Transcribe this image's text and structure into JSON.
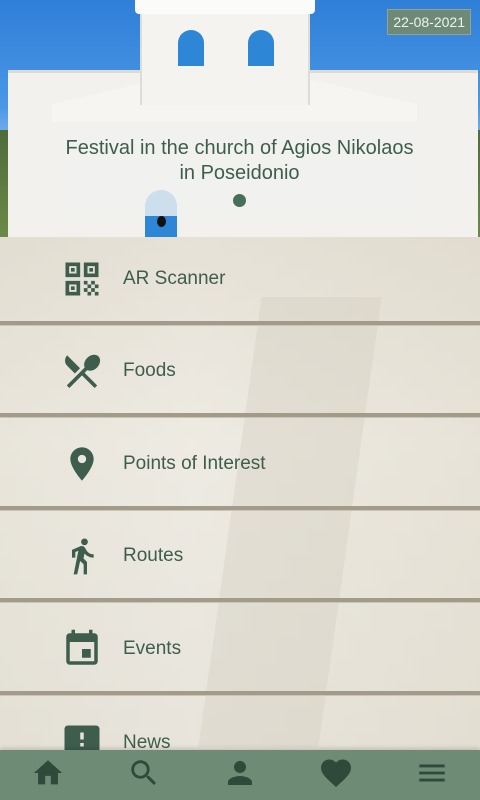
{
  "hero": {
    "date": "22-08-2021",
    "title": "Festival in the church of Agios Nikolaos in Poseidonio"
  },
  "menu": {
    "items": [
      {
        "label": "AR Scanner",
        "icon": "qr-code-icon"
      },
      {
        "label": "Foods",
        "icon": "fork-knife-icon"
      },
      {
        "label": "Points of Interest",
        "icon": "location-pin-icon"
      },
      {
        "label": "Routes",
        "icon": "walking-person-icon"
      },
      {
        "label": "Events",
        "icon": "calendar-icon"
      },
      {
        "label": "News",
        "icon": "news-icon"
      }
    ]
  },
  "bottom_nav": {
    "items": [
      "home-icon",
      "search-icon",
      "profile-icon",
      "favorites-icon",
      "menu-icon"
    ]
  },
  "colors": {
    "accent": "#3f5d4c",
    "nav_background": "#6d8b75",
    "date_badge": "#6e8a77",
    "divider": "#a39b8a"
  }
}
